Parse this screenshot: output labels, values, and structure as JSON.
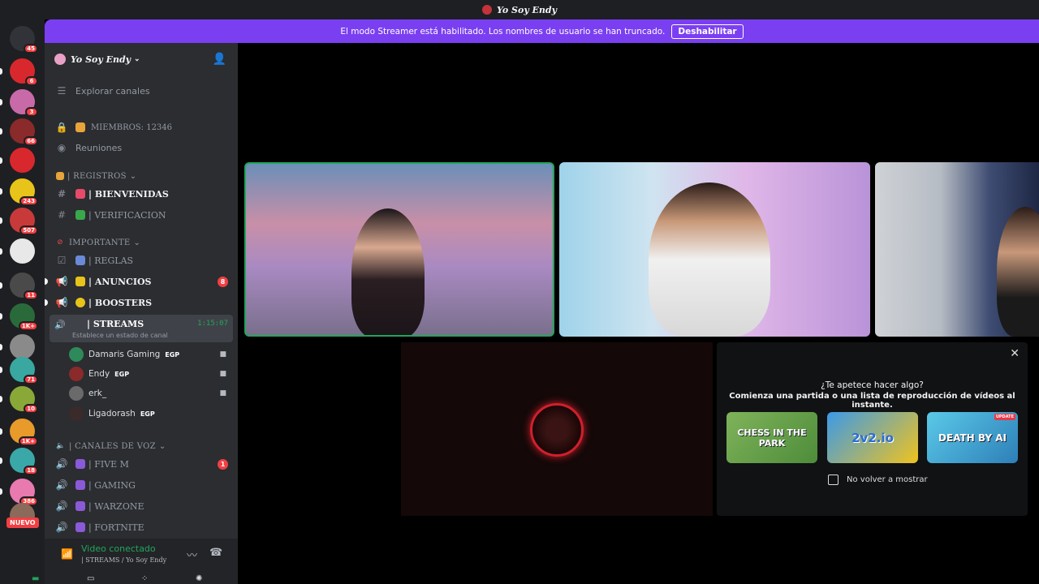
{
  "window": {
    "title": "Yo Soy Endy"
  },
  "banner": {
    "text": "El modo Streamer está habilitado. Los nombres de usuario se han truncado.",
    "button": "Deshabilitar",
    "color": "#7b3ff2"
  },
  "rail": {
    "servers": [
      {
        "badge": "45",
        "color": "#313338"
      },
      {
        "badge": "6",
        "color": "#d8282e"
      },
      {
        "badge": "3",
        "color": "#c86aa8"
      },
      {
        "badge": "66",
        "color": "#8a2a2a"
      },
      {
        "badge": "",
        "color": "#d8282e"
      },
      {
        "badge": "243",
        "color": "#e8c31a"
      },
      {
        "badge": "507",
        "color": "#c83a3a"
      },
      {
        "badge": "",
        "color": "#e8e8e8"
      },
      {
        "badge": "11",
        "color": "#4a4a4a"
      },
      {
        "badge": "1K+",
        "color": "#2a6a3a"
      },
      {
        "badge": "",
        "color": "#8a8a8a"
      },
      {
        "badge": "71",
        "color": "#38a8a0"
      },
      {
        "badge": "10",
        "color": "#8aa838"
      },
      {
        "badge": "1K+",
        "color": "#e89a2a"
      },
      {
        "badge": "18",
        "color": "#3aa8a8"
      },
      {
        "badge": "386",
        "color": "#e87ab0"
      },
      {
        "badge": "",
        "color": "#8a6a5a"
      }
    ],
    "nuevo_label": "NUEVO"
  },
  "sidebar": {
    "guild_name": "Yo Soy Endy",
    "explore": "Explorar canales",
    "members": "MIEMBROS: 12346",
    "meetings": "Reuniones",
    "categories": {
      "registros": "| REGISTROS",
      "importante": "IMPORTANTE",
      "voz": "| CANALES DE VOZ"
    },
    "channels": {
      "bienvenidas": "| BIENVENIDAS",
      "verificacion": "| VERIFICACION",
      "reglas": "| REGLAS",
      "anuncios": "| ANUNCIOS",
      "anuncios_badge": "8",
      "boosters": "| BOOSTERS"
    },
    "streams": {
      "name": "| STREAMS",
      "status": "Establece un estado de canal",
      "time": "1:15:07"
    },
    "voice_users": [
      {
        "name": "Damaris Gaming",
        "tag": "EGP",
        "color": "#2e8a5a"
      },
      {
        "name": "Endy",
        "tag": "EGP",
        "color": "#8a2a2a"
      },
      {
        "name": "erk_",
        "tag": "",
        "color": "#6a6a6a"
      },
      {
        "name": "Ligadorash",
        "tag": "EGP",
        "color": "#3a2a2a"
      }
    ],
    "voice_channels": {
      "fivem": "| FIVE M",
      "fivem_badge": "1",
      "gaming": "| GAMING",
      "warzone": "| WARZONE",
      "fortnite": "| FORTNITE"
    }
  },
  "voice_panel": {
    "status": "Video conectado",
    "location": "| STREAMS / Yo Soy Endy"
  },
  "activity": {
    "question": "¿Te apetece hacer algo?",
    "subtitle": "Comienza una partida o una lista de reproducción de vídeos al instante.",
    "games": [
      "CHESS IN THE PARK",
      "2v2.io",
      "DEATH BY AI"
    ],
    "update_tag": "UPDATE",
    "checkbox": "No volver a mostrar"
  }
}
